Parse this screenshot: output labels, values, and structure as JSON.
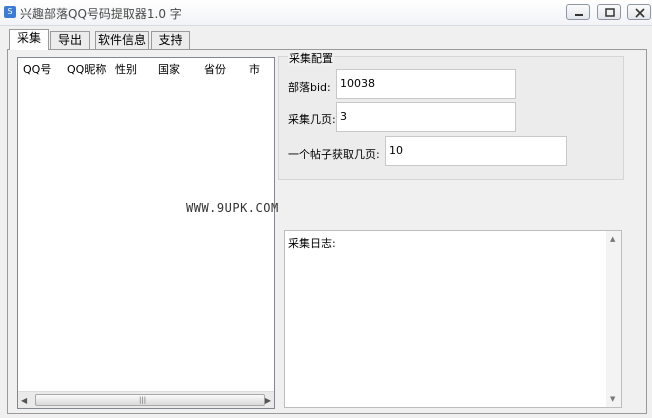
{
  "window": {
    "title": "兴趣部落QQ号码提取器1.0 字",
    "controls": [
      "minimize",
      "maximize",
      "close"
    ]
  },
  "tabs": [
    {
      "label": "采集",
      "active": true
    },
    {
      "label": "导出",
      "active": false
    },
    {
      "label": "软件信息",
      "active": false
    },
    {
      "label": "支持",
      "active": false
    }
  ],
  "table": {
    "columns": [
      "QQ号",
      "QQ昵称",
      "性别",
      "国家",
      "省份",
      "市"
    ],
    "rows": [],
    "scroll_grip": "|||"
  },
  "config": {
    "group_title": "采集配置",
    "fields": [
      {
        "label": "部落bid:",
        "value": "10038"
      },
      {
        "label": "采集几页:",
        "value": "3"
      },
      {
        "label": "一个帖子获取几页:",
        "value": "10"
      }
    ]
  },
  "watermark": "WWW.9UPK.COM",
  "log": {
    "label": "采集日志:",
    "content": ""
  }
}
